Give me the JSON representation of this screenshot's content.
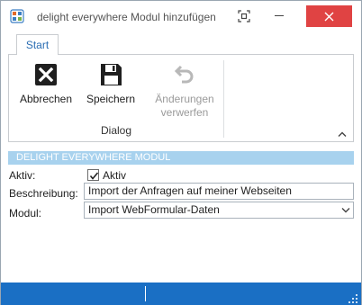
{
  "window": {
    "title": "delight everywhere Modul hinzufügen"
  },
  "ribbon": {
    "tab": "Start",
    "buttons": {
      "abbrechen": "Abbrechen",
      "speichern": "Speichern",
      "aenderungen_line1": "Änderungen",
      "aenderungen_line2": "verwerfen"
    },
    "group_label": "Dialog"
  },
  "section": {
    "header": "DELIGHT EVERYWHERE MODUL"
  },
  "form": {
    "aktiv_label": "Aktiv:",
    "aktiv_checked": true,
    "aktiv_checkbox_label": "Aktiv",
    "beschreibung_label": "Beschreibung:",
    "beschreibung_value": "Import der Anfragen auf meiner Webseiten",
    "modul_label": "Modul:",
    "modul_value": "Import WebFormular-Daten"
  },
  "colors": {
    "accent": "#1a6fc4",
    "section_header_bg": "#a8d2ee",
    "close_button": "#e04343",
    "disabled_text": "#9a9a9a"
  },
  "icons": {
    "app": "app-logo-icon",
    "focus": "focus-mode-icon",
    "minimize": "minimize-icon",
    "close": "close-icon",
    "abbrechen": "cancel-x-icon",
    "speichern": "floppy-disk-icon",
    "aenderungen": "undo-arrow-icon",
    "collapse": "chevron-up-icon",
    "dropdown": "chevron-down-icon"
  }
}
